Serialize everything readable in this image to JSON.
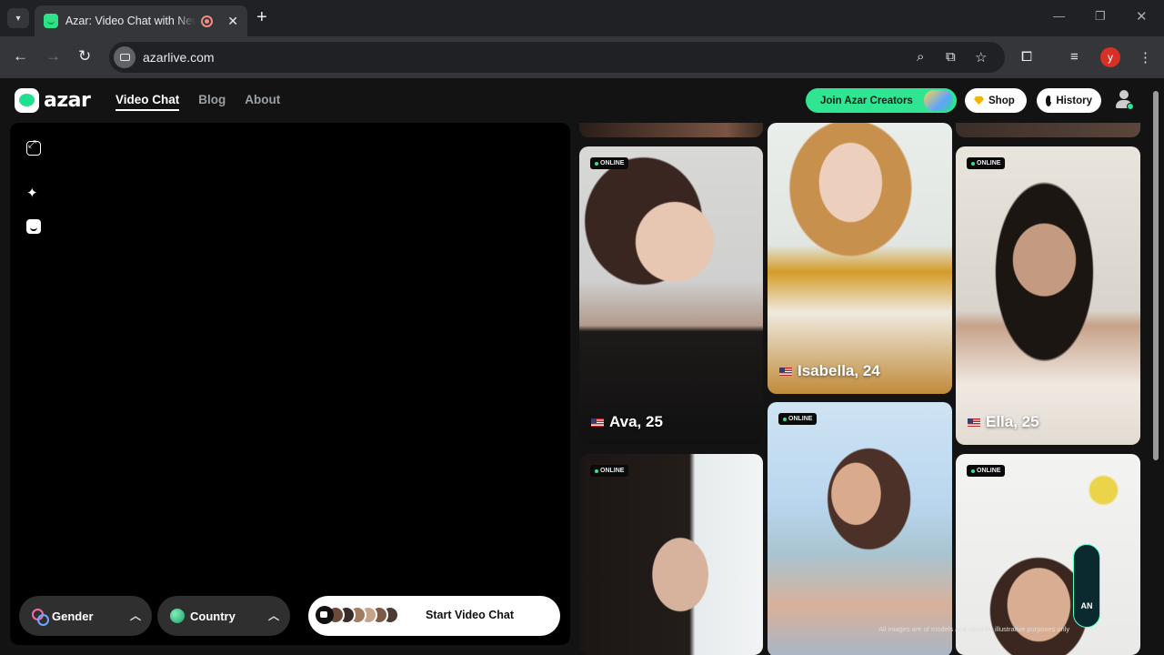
{
  "browser": {
    "tab_title": "Azar: Video Chat with New Friends",
    "url": "azarlive.com",
    "profile_initial": "y"
  },
  "header": {
    "logo_text": "azar",
    "nav": [
      {
        "label": "Video Chat",
        "active": true
      },
      {
        "label": "Blog",
        "active": false
      },
      {
        "label": "About",
        "active": false
      }
    ],
    "creators_label": "Join Azar Creators",
    "shop_label": "Shop",
    "history_label": "History"
  },
  "controls": {
    "gender_label": "Gender",
    "country_label": "Country",
    "start_label": "Start Video Chat"
  },
  "gallery": {
    "online_label": "ONLINE",
    "cards": [
      {
        "name": "Ava, 25",
        "online": true
      },
      {
        "name": "Isabella, 24",
        "online": false
      },
      {
        "name": "Ella, 25",
        "online": true
      },
      {
        "name": "",
        "online": true
      },
      {
        "name": "",
        "online": true
      },
      {
        "name": "",
        "online": true
      }
    ],
    "disclaimer": "All images are of models and used for illustrative purposes only"
  },
  "watermark": {
    "text": "AN"
  },
  "colors": {
    "accent": "#2fe591",
    "page_bg": "#131313",
    "panel_bg": "#000000"
  }
}
